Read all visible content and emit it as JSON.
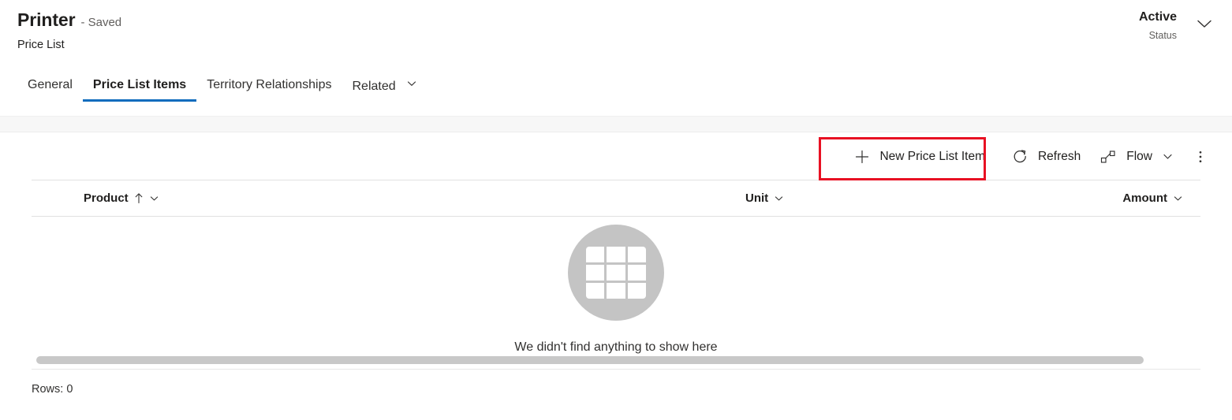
{
  "header": {
    "title": "Printer",
    "saved_state": "- Saved",
    "subtitle": "Price List",
    "status_value": "Active",
    "status_label": "Status",
    "expand_icon": "chevron-down-icon"
  },
  "tabs": [
    {
      "label": "General",
      "active": false,
      "has_chevron": false
    },
    {
      "label": "Price List Items",
      "active": true,
      "has_chevron": false
    },
    {
      "label": "Territory Relationships",
      "active": false,
      "has_chevron": false
    },
    {
      "label": "Related",
      "active": false,
      "has_chevron": true
    }
  ],
  "command_bar": {
    "new_item_label": "New Price List Item",
    "new_item_icon": "plus-icon",
    "refresh_label": "Refresh",
    "refresh_icon": "refresh-icon",
    "flow_label": "Flow",
    "flow_icon": "flow-icon",
    "flow_chevron": "chevron-down-icon",
    "overflow_icon": "more-vertical-icon",
    "highlight_color": "#e81123",
    "highlighted_command": "New Price List Item"
  },
  "grid": {
    "columns": [
      {
        "label": "Product",
        "sort": "ascending",
        "sort_icon": "arrow-up-icon",
        "menu_icon": "chevron-down-icon"
      },
      {
        "label": "Unit",
        "sort": "none",
        "menu_icon": "chevron-down-icon"
      },
      {
        "label": "Amount",
        "sort": "none",
        "menu_icon": "chevron-down-icon"
      }
    ],
    "rows": [],
    "empty_state": {
      "icon": "table-grid-icon",
      "message": "We didn't find anything to show here"
    },
    "footer": {
      "rows_label": "Rows: 0"
    }
  },
  "colors": {
    "accent": "#0f6cbd",
    "highlight": "#e81123",
    "empty_circle": "#c4c4c4",
    "text_primary": "#201f1e",
    "text_secondary": "#605e5c"
  }
}
